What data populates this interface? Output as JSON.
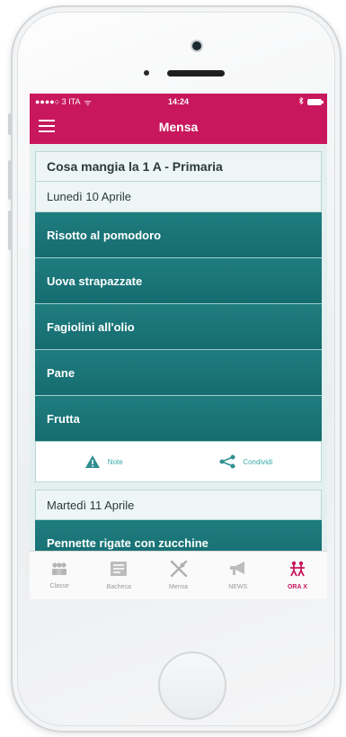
{
  "statusbar": {
    "carrier": "●●●●○ 3 ITA",
    "wifi": "ᯤ",
    "time": "14:24",
    "signal_icon": "bluetooth-icon"
  },
  "nav": {
    "title": "Mensa"
  },
  "menu": {
    "class_title": "Cosa mangia la 1 A - Primaria",
    "days": [
      {
        "date": "Lunedì 10 Aprile",
        "dishes": [
          "Risotto al pomodoro",
          "Uova strapazzate",
          "Fagiolini all'olio",
          "Pane",
          "Frutta"
        ],
        "actions": {
          "note": "Note",
          "share": "Condividi"
        }
      },
      {
        "date": "Martedì 11 Aprile",
        "dishes": [
          "Pennette rigate con zucchine"
        ]
      }
    ]
  },
  "tabs": [
    {
      "label": "Classe",
      "icon": "people-icon"
    },
    {
      "label": "Bacheca",
      "icon": "board-icon"
    },
    {
      "label": "Mensa",
      "icon": "cutlery-icon"
    },
    {
      "label": "NEWS",
      "icon": "megaphone-icon"
    },
    {
      "label": "ORA X",
      "icon": "running-kids-icon"
    }
  ],
  "colors": {
    "brand": "#c8175d",
    "teal": "#1a7478",
    "accent": "#3aa9a9"
  }
}
